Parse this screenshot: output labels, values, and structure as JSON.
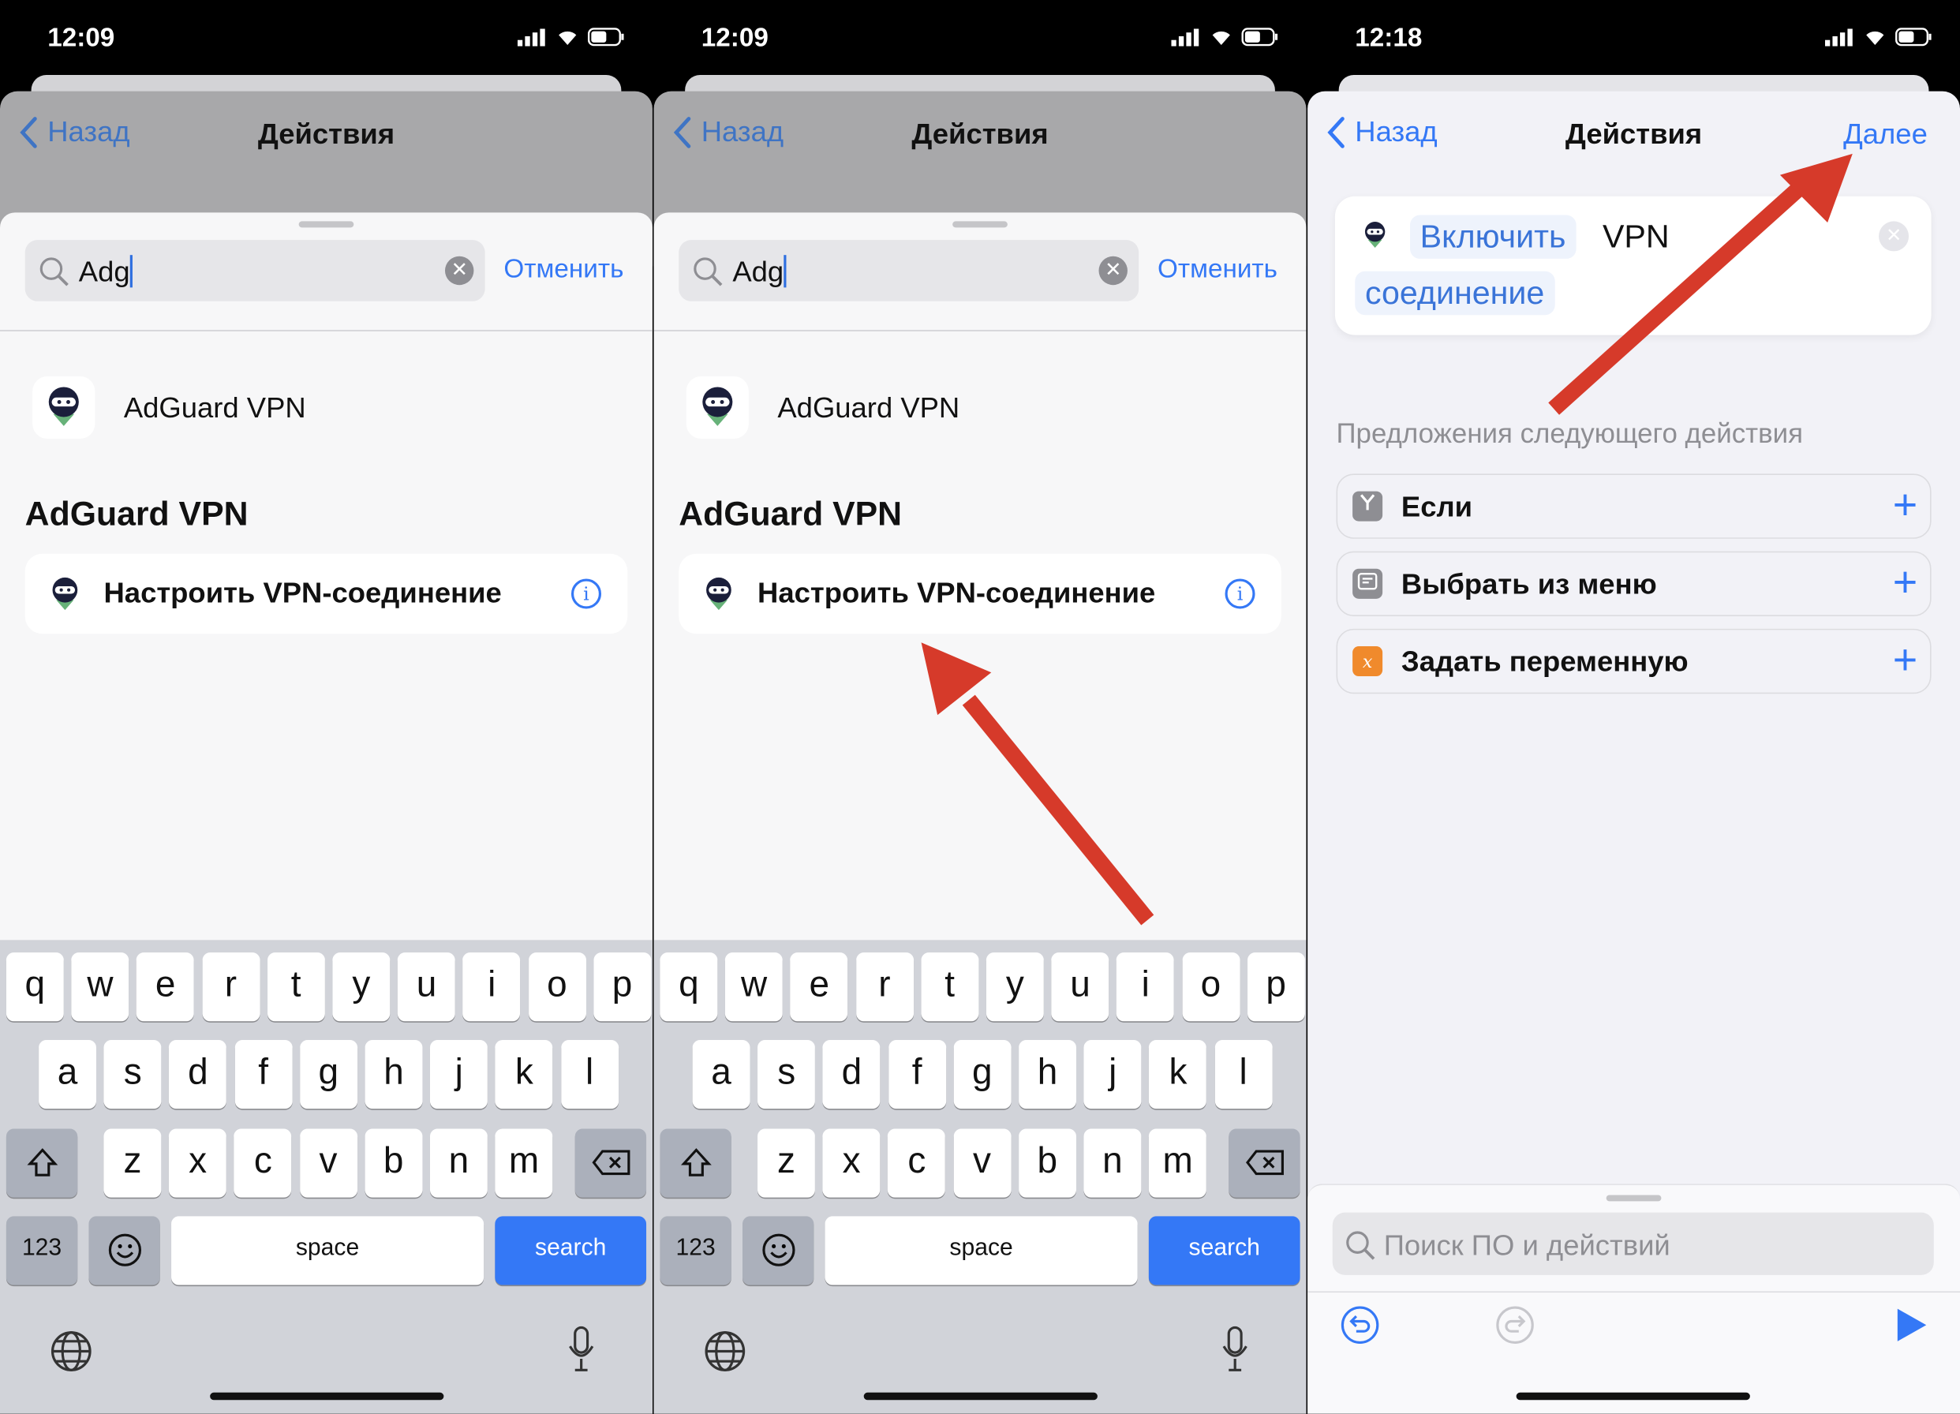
{
  "status_bar": [
    {
      "time": "12:09"
    },
    {
      "time": "12:09"
    },
    {
      "time": "12:18"
    }
  ],
  "nav": {
    "back_label": "Назад",
    "title": "Действия",
    "next_label": "Далее"
  },
  "search": {
    "value": "Adg",
    "cancel_label": "Отменить"
  },
  "results": {
    "app_name": "AdGuard VPN",
    "section_title": "AdGuard VPN",
    "action_label": "Настроить VPN-соединение"
  },
  "keyboard": {
    "row1": [
      "q",
      "w",
      "e",
      "r",
      "t",
      "y",
      "u",
      "i",
      "o",
      "p"
    ],
    "row2": [
      "a",
      "s",
      "d",
      "f",
      "g",
      "h",
      "j",
      "k",
      "l"
    ],
    "row3": [
      "z",
      "x",
      "c",
      "v",
      "b",
      "n",
      "m"
    ],
    "numbers_label": "123",
    "space_label": "space",
    "search_label": "search"
  },
  "editor": {
    "action_verb": "Включить",
    "action_text": "VPN",
    "action_param": "соединение",
    "suggestions_title": "Предложения следующего действия",
    "suggestions": [
      {
        "label": "Если",
        "icon": "branch-icon",
        "color": "#8e8e93"
      },
      {
        "label": "Выбрать из меню",
        "icon": "menu-icon",
        "color": "#8e8e93"
      },
      {
        "label": "Задать переменную",
        "icon": "variable-icon",
        "color": "#f08a2c"
      }
    ],
    "search_placeholder": "Поиск ПО и действий"
  },
  "colors": {
    "accent": "#3478f6",
    "arrow": "#d63a2a"
  }
}
